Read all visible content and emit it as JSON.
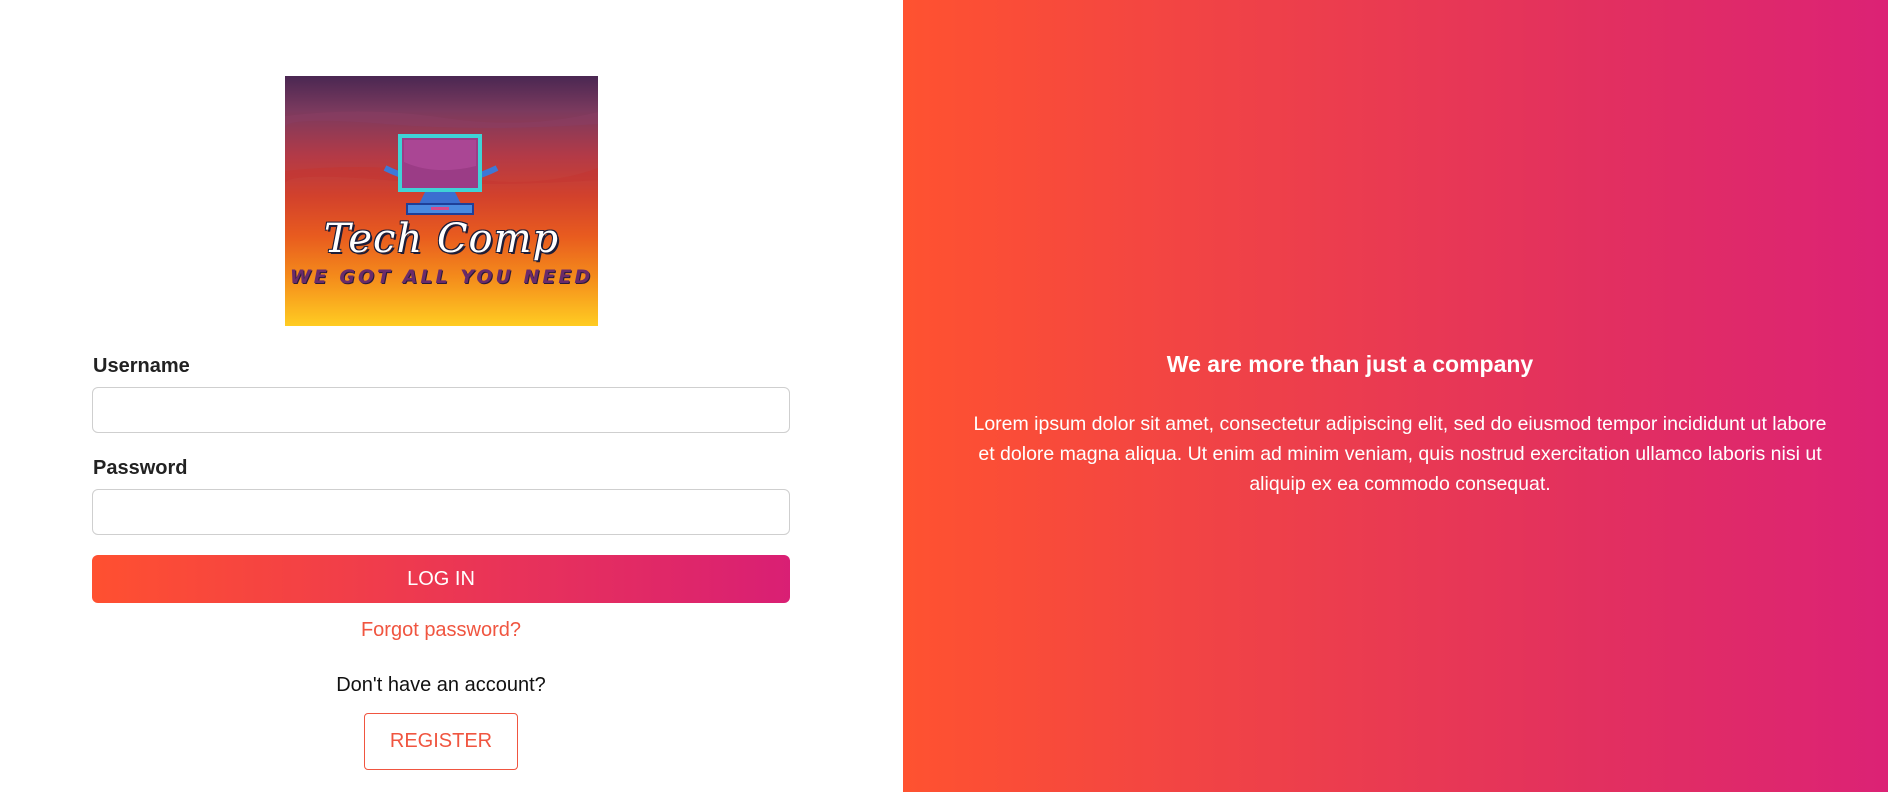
{
  "logo": {
    "title": "Tech Comp",
    "tagline": "WE GOT ALL YOU NEED"
  },
  "login_form": {
    "username_label": "Username",
    "username_value": "",
    "password_label": "Password",
    "password_value": "",
    "login_label": "LOG IN",
    "forgot_password": "Forgot password?",
    "no_account_text": "Don't have an account?",
    "register_label": "REGISTER"
  },
  "promo": {
    "title": "We are more than just a company",
    "text": "Lorem ipsum dolor sit amet, consectetur adipiscing elit, sed do eiusmod tempor incididunt ut labore et dolore magna aliqua. Ut enim ad minim veniam, quis nostrud exercitation ullamco laboris nisi ut aliquip ex ea commodo consequat."
  },
  "colors": {
    "accent": "#f05540",
    "gradient_start": "#ff5230",
    "gradient_end": "#dc2275"
  },
  "icons": {
    "logo_graphic": "computer-monitor-icon"
  }
}
